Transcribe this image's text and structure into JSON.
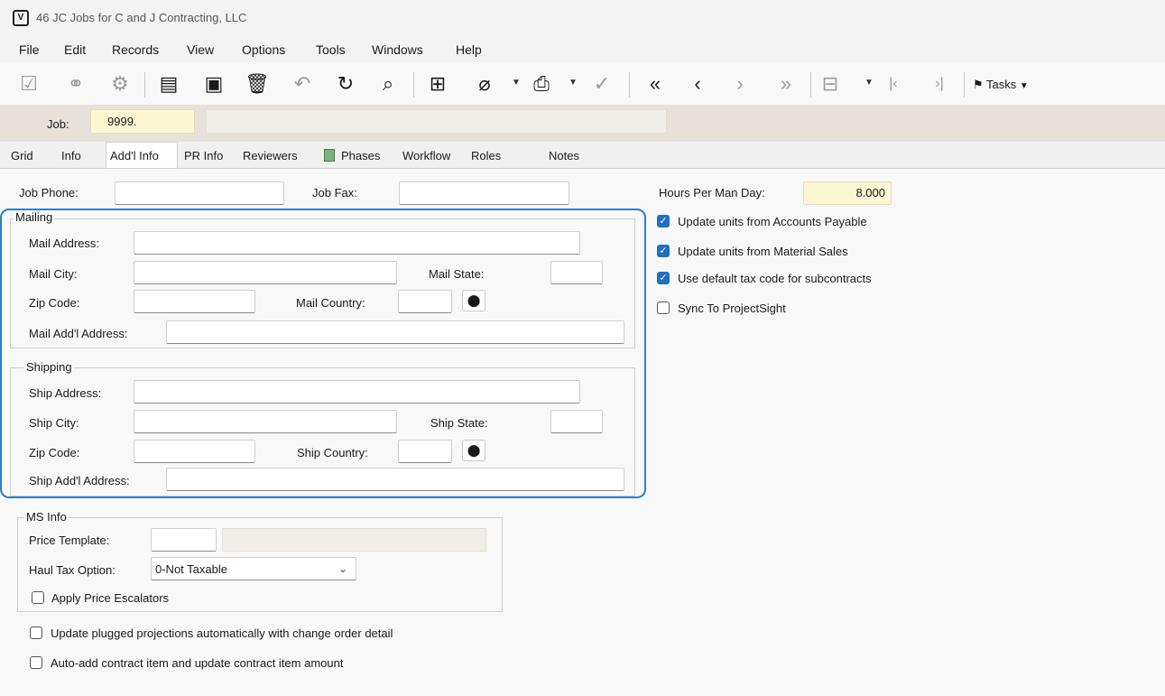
{
  "window": {
    "title": "46 JC Jobs for C and J Contracting, LLC",
    "icon": "app-icon"
  },
  "menu": [
    "File",
    "Edit",
    "Records",
    "View",
    "Options",
    "Tools",
    "Windows",
    "Help"
  ],
  "toolbar": {
    "tasks_label": "Tasks",
    "first": "«",
    "prev": "‹",
    "next": "›",
    "last": "»",
    "start": "|‹",
    "end": "›|"
  },
  "job": {
    "label": "Job:",
    "value": "9999.",
    "description": ""
  },
  "tabs": [
    "Grid",
    "Info",
    "Add'l Info",
    "PR Info",
    "Reviewers",
    "Phases",
    "Workflow",
    "Roles",
    "Notes"
  ],
  "active_tab": "Add'l Info",
  "contact": {
    "phone_label": "Job Phone:",
    "phone_value": "",
    "fax_label": "Job Fax:",
    "fax_value": ""
  },
  "mailing": {
    "legend": "Mailing",
    "address_label": "Mail Address:",
    "city_label": "Mail City:",
    "state_label": "Mail State:",
    "zip_label": "Zip Code:",
    "country_label": "Mail Country:",
    "addl_label": "Mail Add'l Address:"
  },
  "shipping": {
    "legend": "Shipping",
    "address_label": "Ship Address:",
    "city_label": "Ship City:",
    "state_label": "Ship State:",
    "zip_label": "Zip Code:",
    "country_label": "Ship Country:",
    "addl_label": "Ship Add'l Address:"
  },
  "ms_info": {
    "legend": "MS Info",
    "price_template_label": "Price Template:",
    "price_template_value": "",
    "haul_tax_label": "Haul Tax Option:",
    "haul_tax_value": "0-Not Taxable",
    "price_escalators_label": "Apply Price Escalators",
    "price_escalators_checked": false
  },
  "options": {
    "plugged_label": "Update plugged projections automatically with change order detail",
    "plugged_checked": false,
    "autoadd_label": "Auto-add contract item and update contract item amount",
    "autoadd_checked": false
  },
  "right": {
    "hours_label": "Hours Per Man Day:",
    "hours_value": "8.000",
    "ap_label": "Update units from Accounts Payable",
    "ap_checked": true,
    "ms_label": "Update units from Material Sales",
    "ms_checked": true,
    "tax_label": "Use default tax code for subcontracts",
    "tax_checked": true,
    "sync_label": "Sync To ProjectSight",
    "sync_checked": false
  },
  "colors": {
    "highlight": "#2f7fc2",
    "job_field": "#fdf6d2",
    "checkbox_on": "#1f6fc0"
  }
}
